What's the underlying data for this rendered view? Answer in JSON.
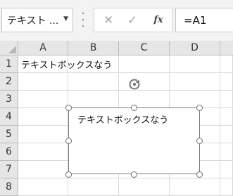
{
  "formula_bar": {
    "name_box_value": "テキスト ...",
    "cancel_glyph": "✕",
    "enter_glyph": "✓",
    "fx_label": "fx",
    "formula_value": "=A1"
  },
  "grid": {
    "columns": [
      "A",
      "B",
      "C",
      "D"
    ],
    "rows": [
      "1",
      "2",
      "3",
      "4",
      "5",
      "6",
      "7",
      "8"
    ],
    "cell_a1": "テキストボックスなう"
  },
  "textbox": {
    "text": "テキストボックスなう"
  }
}
